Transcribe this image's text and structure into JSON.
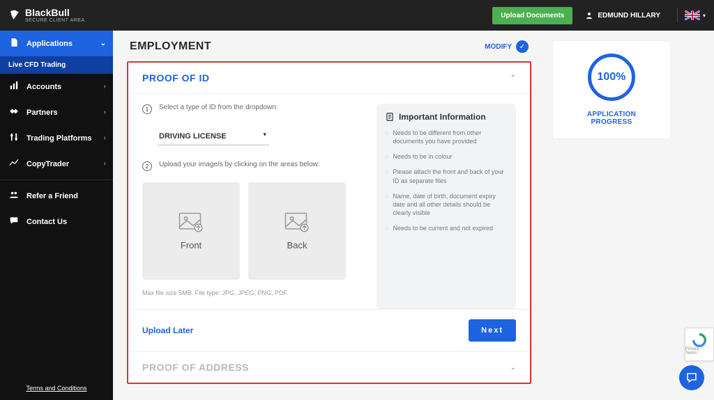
{
  "brand": {
    "name": "BlackBull",
    "sub": "SECURE CLIENT AREA"
  },
  "header": {
    "upload_btn": "Upload Documents",
    "username": "EDMUND HILLARY"
  },
  "sidebar": {
    "items": [
      {
        "label": "Applications",
        "active": true
      },
      {
        "label": "Accounts"
      },
      {
        "label": "Partners"
      },
      {
        "label": "Trading Platforms"
      },
      {
        "label": "CopyTrader"
      }
    ],
    "sub_item": "Live CFD Trading",
    "refer": "Refer a Friend",
    "contact": "Contact Us",
    "tnc": "Terms and Conditions"
  },
  "employment": {
    "title": "EMPLOYMENT",
    "modify": "MODIFY"
  },
  "proof_id": {
    "title": "PROOF OF ID",
    "step1": "Select a type of ID from the dropdown:",
    "select_value": "DRIVING LICENSE",
    "step2": "Upload your image/s by clicking on the areas below:",
    "front": "Front",
    "back": "Back",
    "hint": "Max file size 5MB. File type: JPG, JPEG, PNG, PDF.",
    "upload_later": "Upload Later",
    "next": "Next"
  },
  "info": {
    "title": "Important Information",
    "items": [
      "Needs to be different from other documents you have provided",
      "Needs to be in colour",
      "Please attach the front and back of your ID as separate files",
      "Name, date of birth, document expiry date and all other details should be clearly visible",
      "Needs to be current and not expired"
    ]
  },
  "proof_address": {
    "title": "PROOF OF ADDRESS"
  },
  "progress": {
    "value": "100%",
    "label": "APPLICATION PROGRESS"
  }
}
